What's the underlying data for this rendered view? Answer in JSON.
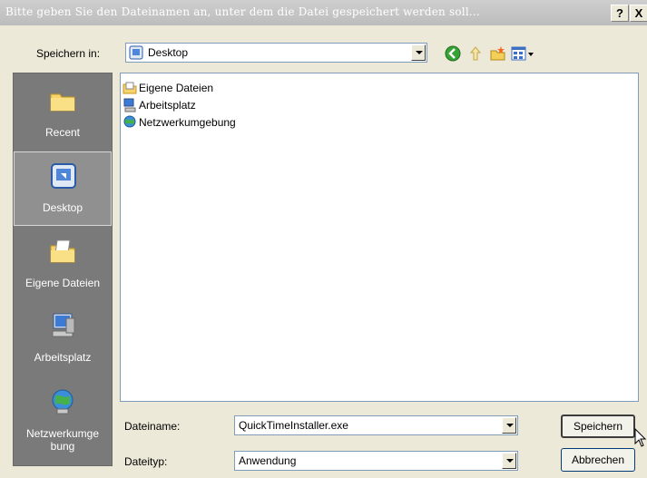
{
  "window": {
    "title": "Bitte geben Sie den Dateinamen an, unter dem die Datei gespeichert werden soll...",
    "help_label": "?",
    "close_label": "X"
  },
  "toolbar": {
    "save_in_label": "Speichern in:",
    "location_value": "Desktop",
    "icons": [
      "back-icon",
      "up-folder-icon",
      "new-folder-icon",
      "view-menu-icon"
    ]
  },
  "places": [
    {
      "label": "Recent",
      "icon": "recent-folder-icon"
    },
    {
      "label": "Desktop",
      "icon": "desktop-icon",
      "active": true
    },
    {
      "label": "Eigene Dateien",
      "icon": "my-documents-icon"
    },
    {
      "label": "Arbeitsplatz",
      "icon": "my-computer-icon"
    },
    {
      "label": "Netzwerkumge bung",
      "icon": "network-icon"
    }
  ],
  "files": [
    {
      "name": "Eigene Dateien",
      "icon": "documents-folder-icon"
    },
    {
      "name": "Arbeitsplatz",
      "icon": "computer-icon"
    },
    {
      "name": "Netzwerkumgebung",
      "icon": "network-icon"
    }
  ],
  "form": {
    "filename_label": "Dateiname:",
    "filename_value": "QuickTimeInstaller.exe",
    "filetype_label": "Dateityp:",
    "filetype_value": "Anwendung"
  },
  "buttons": {
    "save_label": "Speichern",
    "cancel_label": "Abbrechen"
  },
  "colors": {
    "places_bar": "#7a7a7a",
    "dialog_bg": "#ece9d8",
    "border_blue": "#7f9db9"
  }
}
